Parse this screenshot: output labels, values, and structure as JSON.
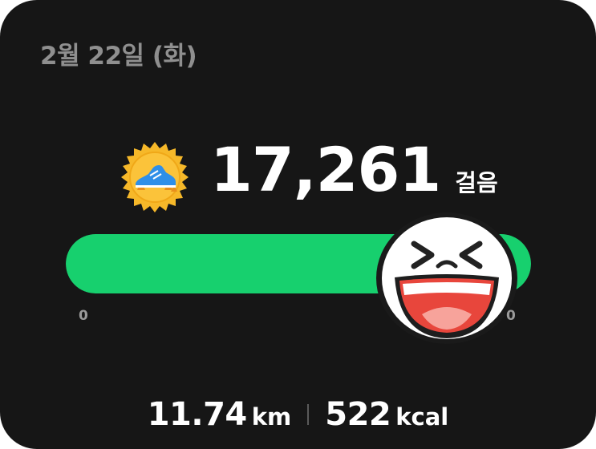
{
  "summary": {
    "date": "2월 22일 (화)"
  },
  "steps": {
    "count": "17,261",
    "unit": "걸음",
    "badge_icon": "running-shoe-badge-icon",
    "progress_percent": 100,
    "range_min_label": "0",
    "range_max_label": "0"
  },
  "stats": {
    "distance_value": "11.74",
    "distance_unit": "km",
    "calories_value": "522",
    "calories_unit": "kcal"
  },
  "sticker": {
    "icon": "laughing-face-sticker-icon"
  },
  "colors": {
    "background": "#161616",
    "progress_fill": "#17d06e",
    "badge": "#f6b829",
    "text": "#ffffff",
    "muted_text": "#8f8f8f"
  }
}
